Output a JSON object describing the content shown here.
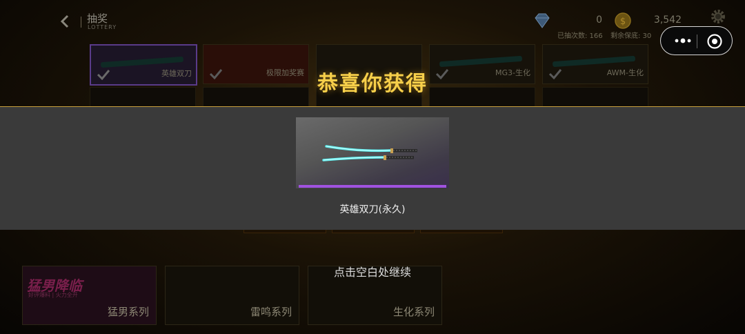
{
  "header": {
    "title": "抽奖",
    "subtitle": "LOTTERY",
    "diamond_amount": "0",
    "gold_amount": "3,542",
    "draw_count_label": "已抽次数: 166",
    "guarantee_label": "剩余保底: 30"
  },
  "prize_cards": [
    {
      "label": "英雄双刀"
    },
    {
      "label": "极限加奖赛"
    },
    {
      "label": ""
    },
    {
      "label": "MG3-生化"
    },
    {
      "label": "AWM-生化"
    }
  ],
  "series": [
    {
      "label": "猛男系列",
      "logo": "猛男降临",
      "sub": "好评爆料 | 火力全开"
    },
    {
      "label": "雷鸣系列"
    },
    {
      "label": "生化系列"
    }
  ],
  "overlay": {
    "congrats": "恭喜你获得",
    "prize_name": "英雄双刀(永久)",
    "continue_hint": "点击空白处继续"
  },
  "colors": {
    "gold_text": "#f7cf4a",
    "rarity_purple": "#a052e0",
    "band_gray": "#3a3a3a",
    "blade_cyan": "#5ff0f0"
  }
}
